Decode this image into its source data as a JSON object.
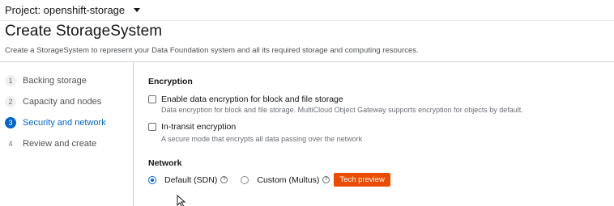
{
  "project": {
    "label": "Project: openshift-storage"
  },
  "page": {
    "title": "Create StorageSystem",
    "description": "Create a StorageSystem to represent your Data Foundation system and all its required storage and computing resources."
  },
  "wizard": {
    "steps": [
      {
        "number": "1",
        "label": "Backing storage",
        "state": "completed"
      },
      {
        "number": "2",
        "label": "Capacity and nodes",
        "state": "completed"
      },
      {
        "number": "3",
        "label": "Security and network",
        "state": "current"
      },
      {
        "number": "4",
        "label": "Review and create",
        "state": "future"
      }
    ]
  },
  "encryption": {
    "heading": "Encryption",
    "data_encryption": {
      "label": "Enable data encryption for block and file storage",
      "helper": "Data encryption for block and file storage. MultiCloud Object Gateway supports encryption for objects by default.",
      "checked": false
    },
    "in_transit": {
      "label": "In-transit encryption",
      "helper": "A secure mode that encrypts all data passing over the network",
      "checked": false
    }
  },
  "network": {
    "heading": "Network",
    "options": [
      {
        "label": "Default (SDN)",
        "checked": true
      },
      {
        "label": "Custom (Multus)",
        "checked": false
      }
    ],
    "badge": "Tech preview"
  },
  "colors": {
    "accent": "#0066cc",
    "badge": "#ec4c00"
  }
}
